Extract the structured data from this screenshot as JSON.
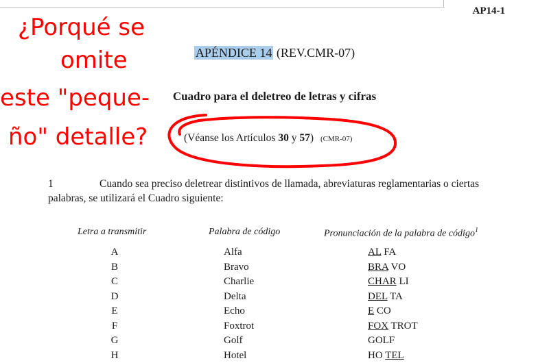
{
  "header": {
    "code": "AP14-1"
  },
  "doc": {
    "appendix_highlight": "APÉNDICE 14",
    "appendix_rest": " (REV.CMR-07)",
    "subtitle": "Cuadro para el deletreo de letras y cifras",
    "ref_prefix": "(Véanse los Artículos ",
    "ref_a": "30",
    "ref_y": " y ",
    "ref_b": "57",
    "ref_close": ")",
    "ref_small": "(CMR-07)",
    "para_num": "1",
    "para_text": "Cuando sea preciso deletrear distintivos de llamada, abreviaturas reglamentarias o ciertas palabras, se utilizará el Cuadro siguiente:"
  },
  "table": {
    "headers": [
      "Letra a transmitir",
      "Palabra de código",
      "Pronunciación de la palabra de código"
    ],
    "footnote_mark": "1",
    "rows": [
      {
        "letter": "A",
        "word": "Alfa",
        "pron": [
          "AL",
          " FA"
        ]
      },
      {
        "letter": "B",
        "word": "Bravo",
        "pron": [
          "BRA",
          " VO"
        ]
      },
      {
        "letter": "C",
        "word": "Charlie",
        "pron": [
          "CHAR",
          " LI"
        ]
      },
      {
        "letter": "D",
        "word": "Delta",
        "pron": [
          "DEL",
          " TA"
        ]
      },
      {
        "letter": "E",
        "word": "Echo",
        "pron": [
          "E",
          " CO"
        ]
      },
      {
        "letter": "F",
        "word": "Foxtrot",
        "pron": [
          "FOX",
          " TROT"
        ]
      },
      {
        "letter": "G",
        "word": "Golf",
        "pron": [
          "",
          "GOLF"
        ]
      },
      {
        "letter": "H",
        "word": "Hotel",
        "pron": [
          "HO ",
          "TEL"
        ]
      }
    ]
  },
  "annotation": {
    "line1": "¿Porqué se",
    "line2": "omite",
    "line3": "este \"peque-",
    "line4": "ño\" detalle?",
    "color": "#ff0000"
  }
}
